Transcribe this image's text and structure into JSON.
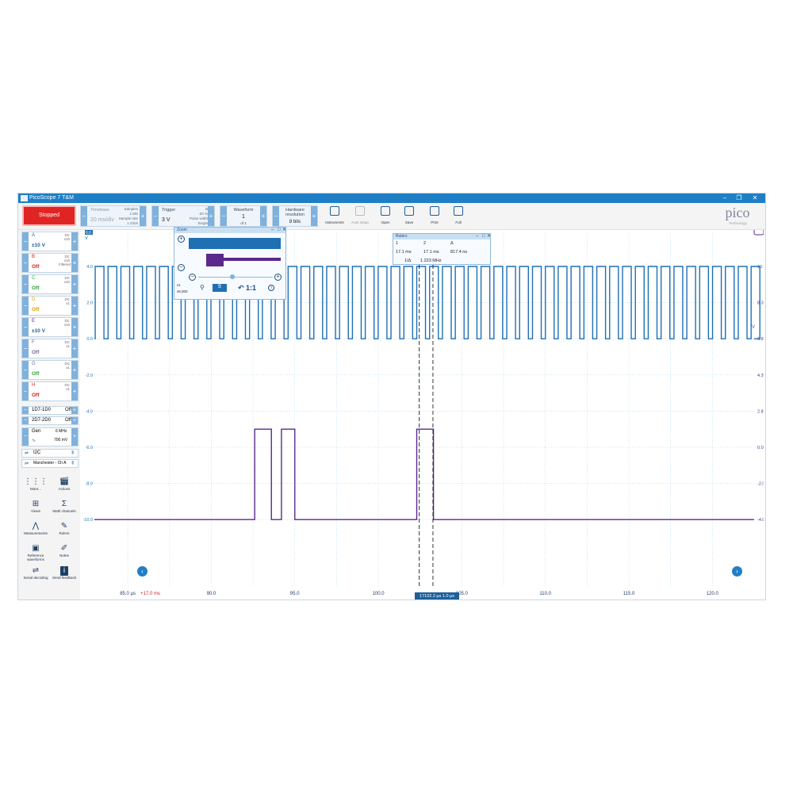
{
  "app": {
    "title": "PicoScope 7 T&M",
    "brand": "pico",
    "brand_sub": "Technology"
  },
  "toolbar": {
    "run_status": "Stopped",
    "timebase_label": "Timebase",
    "timebase_value": "20 ms/div",
    "samples_label": "Samples",
    "samples_value": "1 MS",
    "sample_rate_label": "Sample rate",
    "sample_rate_value": "1 GS/s",
    "trigger_label": "Trigger",
    "trigger_value": "3 V",
    "trigger_channel": "B",
    "trigger_percent": "-20 %",
    "trigger_type": "Pulse width",
    "trigger_mode": "Single",
    "waveform_label": "Waveform",
    "waveform_value": "1",
    "waveform_of": "of 1",
    "resolution_label": "Hardware resolution",
    "resolution_value": "8 bits",
    "buttons": [
      "Instruments",
      "Auto setup",
      "Open",
      "Save",
      "Print",
      "Full"
    ]
  },
  "channels": [
    {
      "name": "A",
      "coupling": "DC",
      "probe": "x10",
      "range": "±10 V",
      "color": "#1f6fb5"
    },
    {
      "name": "B",
      "coupling": "DC",
      "probe": "x10",
      "extra": "Filtered",
      "range": "Off",
      "color": "#d02020"
    },
    {
      "name": "C",
      "coupling": "DC",
      "probe": "x10",
      "range": "Off",
      "color": "#2e9e3a"
    },
    {
      "name": "D",
      "coupling": "DC",
      "probe": "x1",
      "range": "Off",
      "color": "#e0a000"
    },
    {
      "name": "E",
      "coupling": "DC",
      "probe": "x10",
      "range": "±10 V",
      "color": "#6a1f9a"
    },
    {
      "name": "F",
      "coupling": "DC",
      "probe": "x1",
      "range": "Off",
      "color": "#7a6a9a"
    },
    {
      "name": "G",
      "coupling": "DC",
      "probe": "x1",
      "range": "Off",
      "color": "#7a6a9a"
    },
    {
      "name": "H",
      "coupling": "DC",
      "probe": "x1",
      "range": "Off",
      "color": "#d02020"
    }
  ],
  "digital": [
    {
      "name": "1D7-1D0",
      "state": "Off"
    },
    {
      "name": "2D7-2D0",
      "state": "Off"
    }
  ],
  "generator": {
    "label": "Gen",
    "freq": "6 MHz",
    "ampl": "700 mV"
  },
  "decoders": [
    "I2C",
    "Manchester - Ch A"
  ],
  "tools": [
    "More...",
    "Actions",
    "Views",
    "Math channels",
    "Measurements",
    "Rulers",
    "Reference waveforms",
    "Notes",
    "Serial decoding",
    "Send feedback"
  ],
  "scope": {
    "left_axis_unit": "V",
    "right_axis_unit": "V",
    "left_ticks": [
      "4.0",
      "2.0",
      "0.0",
      "-2.0",
      "-4.0",
      "-6.0",
      "-8.0",
      "-10.0"
    ],
    "right_ticks": [
      "10.0",
      "8.3",
      "6.8",
      "4.3",
      "2.8",
      "0.0",
      "-2.0",
      "-4.0"
    ],
    "time_ticks": [
      "85.0 µs",
      "90.0",
      "95.0",
      "100.0",
      "105.0",
      "110.0",
      "115.0",
      "120.0"
    ],
    "time_offset": "+17.0 ms",
    "ruler_readout": "17102.2 µs 1.0 µs",
    "channel_a_marker": "6.0"
  },
  "zoom_panel": {
    "title": "Zoom",
    "scale": "x1",
    "factor": "x6,000",
    "reset": "1:1"
  },
  "rulers_panel": {
    "title": "Rulers",
    "headers": [
      "1",
      "2",
      "Δ"
    ],
    "values": [
      "17.1 ms",
      "17.1 ms",
      "817.4 ns"
    ],
    "freq_label": "1/Δ",
    "freq_value": "1.223 MHz"
  },
  "chart_data": {
    "type": "line",
    "series": [
      {
        "name": "A",
        "color": "#1f6fb5"
      },
      {
        "name": "E",
        "color": "#5b2a8c"
      }
    ],
    "xlim": [
      83.0,
      122.5
    ],
    "ylim": [
      -10.0,
      4.0
    ],
    "a_high": 4.0,
    "a_low": 0.0,
    "a_period_us": 0.77,
    "e_high": -5.0,
    "e_low": -10.0,
    "e_pulses": [
      [
        92.6,
        93.6
      ],
      [
        94.2,
        95.0
      ],
      [
        102.3,
        103.3
      ]
    ],
    "rulers_x": [
      102.45,
      103.27
    ]
  }
}
